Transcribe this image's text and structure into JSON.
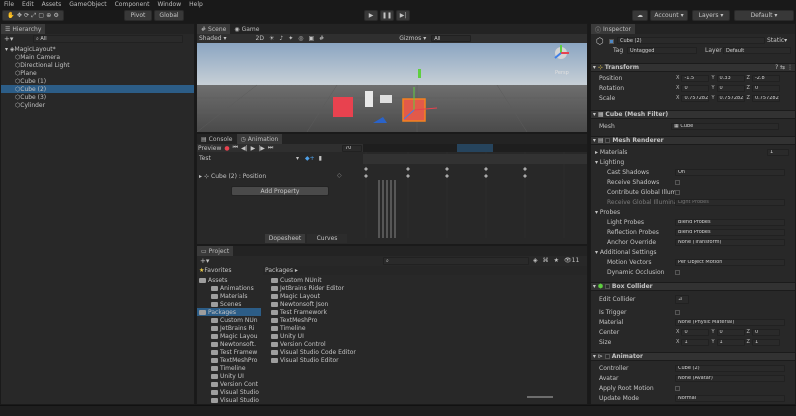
{
  "menu": [
    "File",
    "Edit",
    "Assets",
    "GameObject",
    "Component",
    "Window",
    "Help"
  ],
  "toolbar": {
    "pivot": "Pivot",
    "global": "Global",
    "account": "Account",
    "layers": "Layers",
    "layout": "Default"
  },
  "hierarchy": {
    "tab": "Hierarchy",
    "search_placeholder": "All",
    "items": [
      {
        "label": "MagicLayout*",
        "indent": 0
      },
      {
        "label": "Main Camera",
        "indent": 1
      },
      {
        "label": "Directional Light",
        "indent": 1
      },
      {
        "label": "Plane",
        "indent": 1
      },
      {
        "label": "Cube (1)",
        "indent": 1
      },
      {
        "label": "Cube (2)",
        "indent": 1,
        "selected": true
      },
      {
        "label": "Cube (3)",
        "indent": 1
      },
      {
        "label": "Cylinder",
        "indent": 1
      }
    ]
  },
  "scene": {
    "tabs": [
      "Scene",
      "Game"
    ],
    "shading": "Shaded",
    "mode2d": "2D",
    "gizmos": "Gizmos",
    "search": "All",
    "view": "Persp"
  },
  "animation": {
    "tabs": [
      "Console",
      "Animation"
    ],
    "preview": "Preview",
    "frame": "70",
    "clip": "Test",
    "prop": "Cube (2) : Position",
    "add_property": "Add Property",
    "dopesheet": "Dopesheet",
    "curves": "Curves"
  },
  "project": {
    "tab": "Project",
    "favorites": "Favorites",
    "assets_label": "Assets",
    "assets": [
      "Animations",
      "Materials",
      "Scenes"
    ],
    "packages_label": "Packages",
    "packages": [
      "Custom NUnit",
      "JetBrains Rider Editor",
      "Magic Layout",
      "Newtonsoft Json",
      "Test Framework",
      "TextMeshPro",
      "Timeline",
      "Unity UI",
      "Version Control",
      "Visual Studio Code Editor",
      "Visual Studio Editor"
    ],
    "tree_packages": [
      "Custom NUn",
      "JetBrains Ri",
      "Magic Layou",
      "Newtonsoft.",
      "Test Framew",
      "TextMeshPro",
      "Timeline",
      "Unity UI",
      "Version Cont",
      "Visual Studio",
      "Visual Studio"
    ],
    "breadcrumb": "Packages",
    "count": "11"
  },
  "inspector": {
    "tab": "Inspector",
    "static": "Static",
    "object_name": "Cube (2)",
    "tag_label": "Tag",
    "tag": "Untagged",
    "layer_label": "Layer",
    "layer": "Default",
    "transform": {
      "title": "Transform",
      "rows": [
        {
          "label": "Position",
          "x": "-1.5",
          "y": "0.33",
          "z": "-2.8"
        },
        {
          "label": "Rotation",
          "x": "0",
          "y": "0",
          "z": "0"
        },
        {
          "label": "Scale",
          "x": "0.757282",
          "y": "0.757282",
          "z": "0.757282"
        }
      ]
    },
    "mesh_filter": {
      "title": "Cube (Mesh Filter)",
      "mesh_label": "Mesh",
      "mesh": "Cube"
    },
    "mesh_renderer": {
      "title": "Mesh Renderer",
      "materials": "Materials",
      "materials_count": "1",
      "lighting": "Lighting",
      "cast_shadows_label": "Cast Shadows",
      "cast_shadows": "On",
      "receive_shadows": "Receive Shadows",
      "contribute_gi": "Contribute Global Illumination",
      "receive_gi_label": "Receive Global Illuminati",
      "receive_gi": "Light Probes",
      "probes": "Probes",
      "light_probes_label": "Light Probes",
      "light_probes": "Blend Probes",
      "reflection_probes_label": "Reflection Probes",
      "reflection_probes": "Blend Probes",
      "anchor_label": "Anchor Override",
      "anchor": "None (Transform)",
      "additional": "Additional Settings",
      "motion_label": "Motion Vectors",
      "motion": "Per Object Motion",
      "dynamic_occlusion": "Dynamic Occlusion"
    },
    "box_collider": {
      "title": "Box Collider",
      "edit": "Edit Collider",
      "trigger": "Is Trigger",
      "material_label": "Material",
      "material": "None (Physic Material)",
      "center_label": "Center",
      "center": {
        "x": "0",
        "y": "0",
        "z": "0"
      },
      "size_label": "Size",
      "size": {
        "x": "1",
        "y": "1",
        "z": "1"
      }
    },
    "animator": {
      "title": "Animator",
      "controller_label": "Controller",
      "controller": "Cube (2)",
      "avatar_label": "Avatar",
      "avatar": "None (Avatar)",
      "root_motion": "Apply Root Motion",
      "update_label": "Update Mode",
      "update": "Normal"
    }
  },
  "colors": {
    "accent": "#2c5d87",
    "selection": "#f5821f",
    "cube_red": "#e8424f"
  }
}
